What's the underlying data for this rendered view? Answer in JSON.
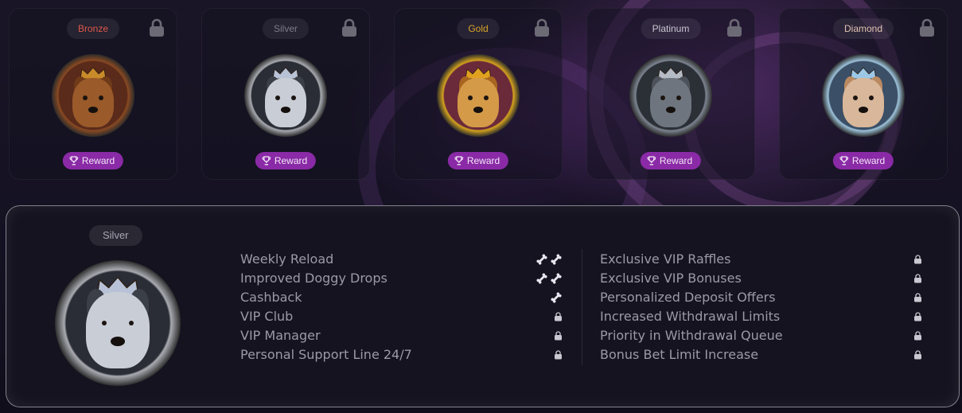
{
  "tiers": [
    {
      "name": "Bronze",
      "badge_color": "#d9584a",
      "ring": "#8a4a22",
      "reward_label": "Reward",
      "icon": "lock-icon"
    },
    {
      "name": "Silver",
      "badge_color": "#7e7b89",
      "ring": "#a9abb1",
      "reward_label": "Reward",
      "icon": "lock-icon"
    },
    {
      "name": "Gold",
      "badge_color": "#d7a52a",
      "ring": "#d4a21e",
      "reward_label": "Reward",
      "icon": "lock-icon"
    },
    {
      "name": "Platinum",
      "badge_color": "#c9c7d2",
      "ring": "#7d8590",
      "reward_label": "Reward",
      "icon": "lock-icon"
    },
    {
      "name": "Diamond",
      "badge_color": "#e0c3b0",
      "ring": "#9ec4dc",
      "reward_label": "Reward",
      "icon": "lock-icon"
    }
  ],
  "detail": {
    "selected_tier": "Silver",
    "left_benefits": [
      {
        "label": "Weekly Reload",
        "status": "bones",
        "count": 2
      },
      {
        "label": "Improved Doggy Drops",
        "status": "bones",
        "count": 2
      },
      {
        "label": "Cashback",
        "status": "bones",
        "count": 1
      },
      {
        "label": "VIP Club",
        "status": "locked"
      },
      {
        "label": "VIP Manager",
        "status": "locked"
      },
      {
        "label": "Personal Support Line 24/7",
        "status": "locked"
      }
    ],
    "right_benefits": [
      {
        "label": "Exclusive VIP Raffles",
        "status": "locked"
      },
      {
        "label": "Exclusive VIP Bonuses",
        "status": "locked"
      },
      {
        "label": "Personalized Deposit Offers",
        "status": "locked"
      },
      {
        "label": "Increased Withdrawal Limits",
        "status": "locked"
      },
      {
        "label": "Priority in Withdrawal Queue",
        "status": "locked"
      },
      {
        "label": "Bonus Bet Limit Increase",
        "status": "locked"
      }
    ]
  },
  "colors": {
    "accent": "#8a2aa6",
    "panel_border": "#d0d0d8",
    "text": "#9c99a8"
  }
}
